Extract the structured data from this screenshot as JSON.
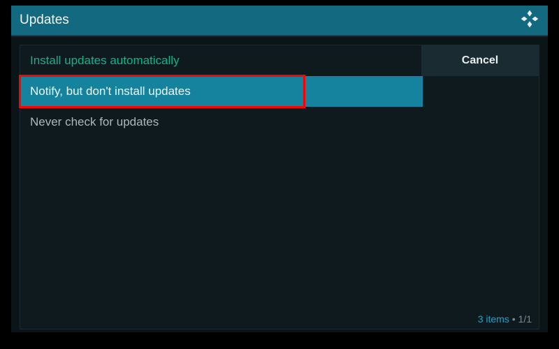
{
  "title": "Updates",
  "options": [
    {
      "label": "Install updates automatically",
      "state": "current"
    },
    {
      "label": "Notify, but don't install updates",
      "state": "selected",
      "highlighted": true
    },
    {
      "label": "Never check for updates",
      "state": "plain"
    }
  ],
  "buttons": {
    "cancel": "Cancel"
  },
  "status": {
    "count": "3 items",
    "page": "1/1"
  },
  "icons": {
    "app": "kodi-logo"
  }
}
